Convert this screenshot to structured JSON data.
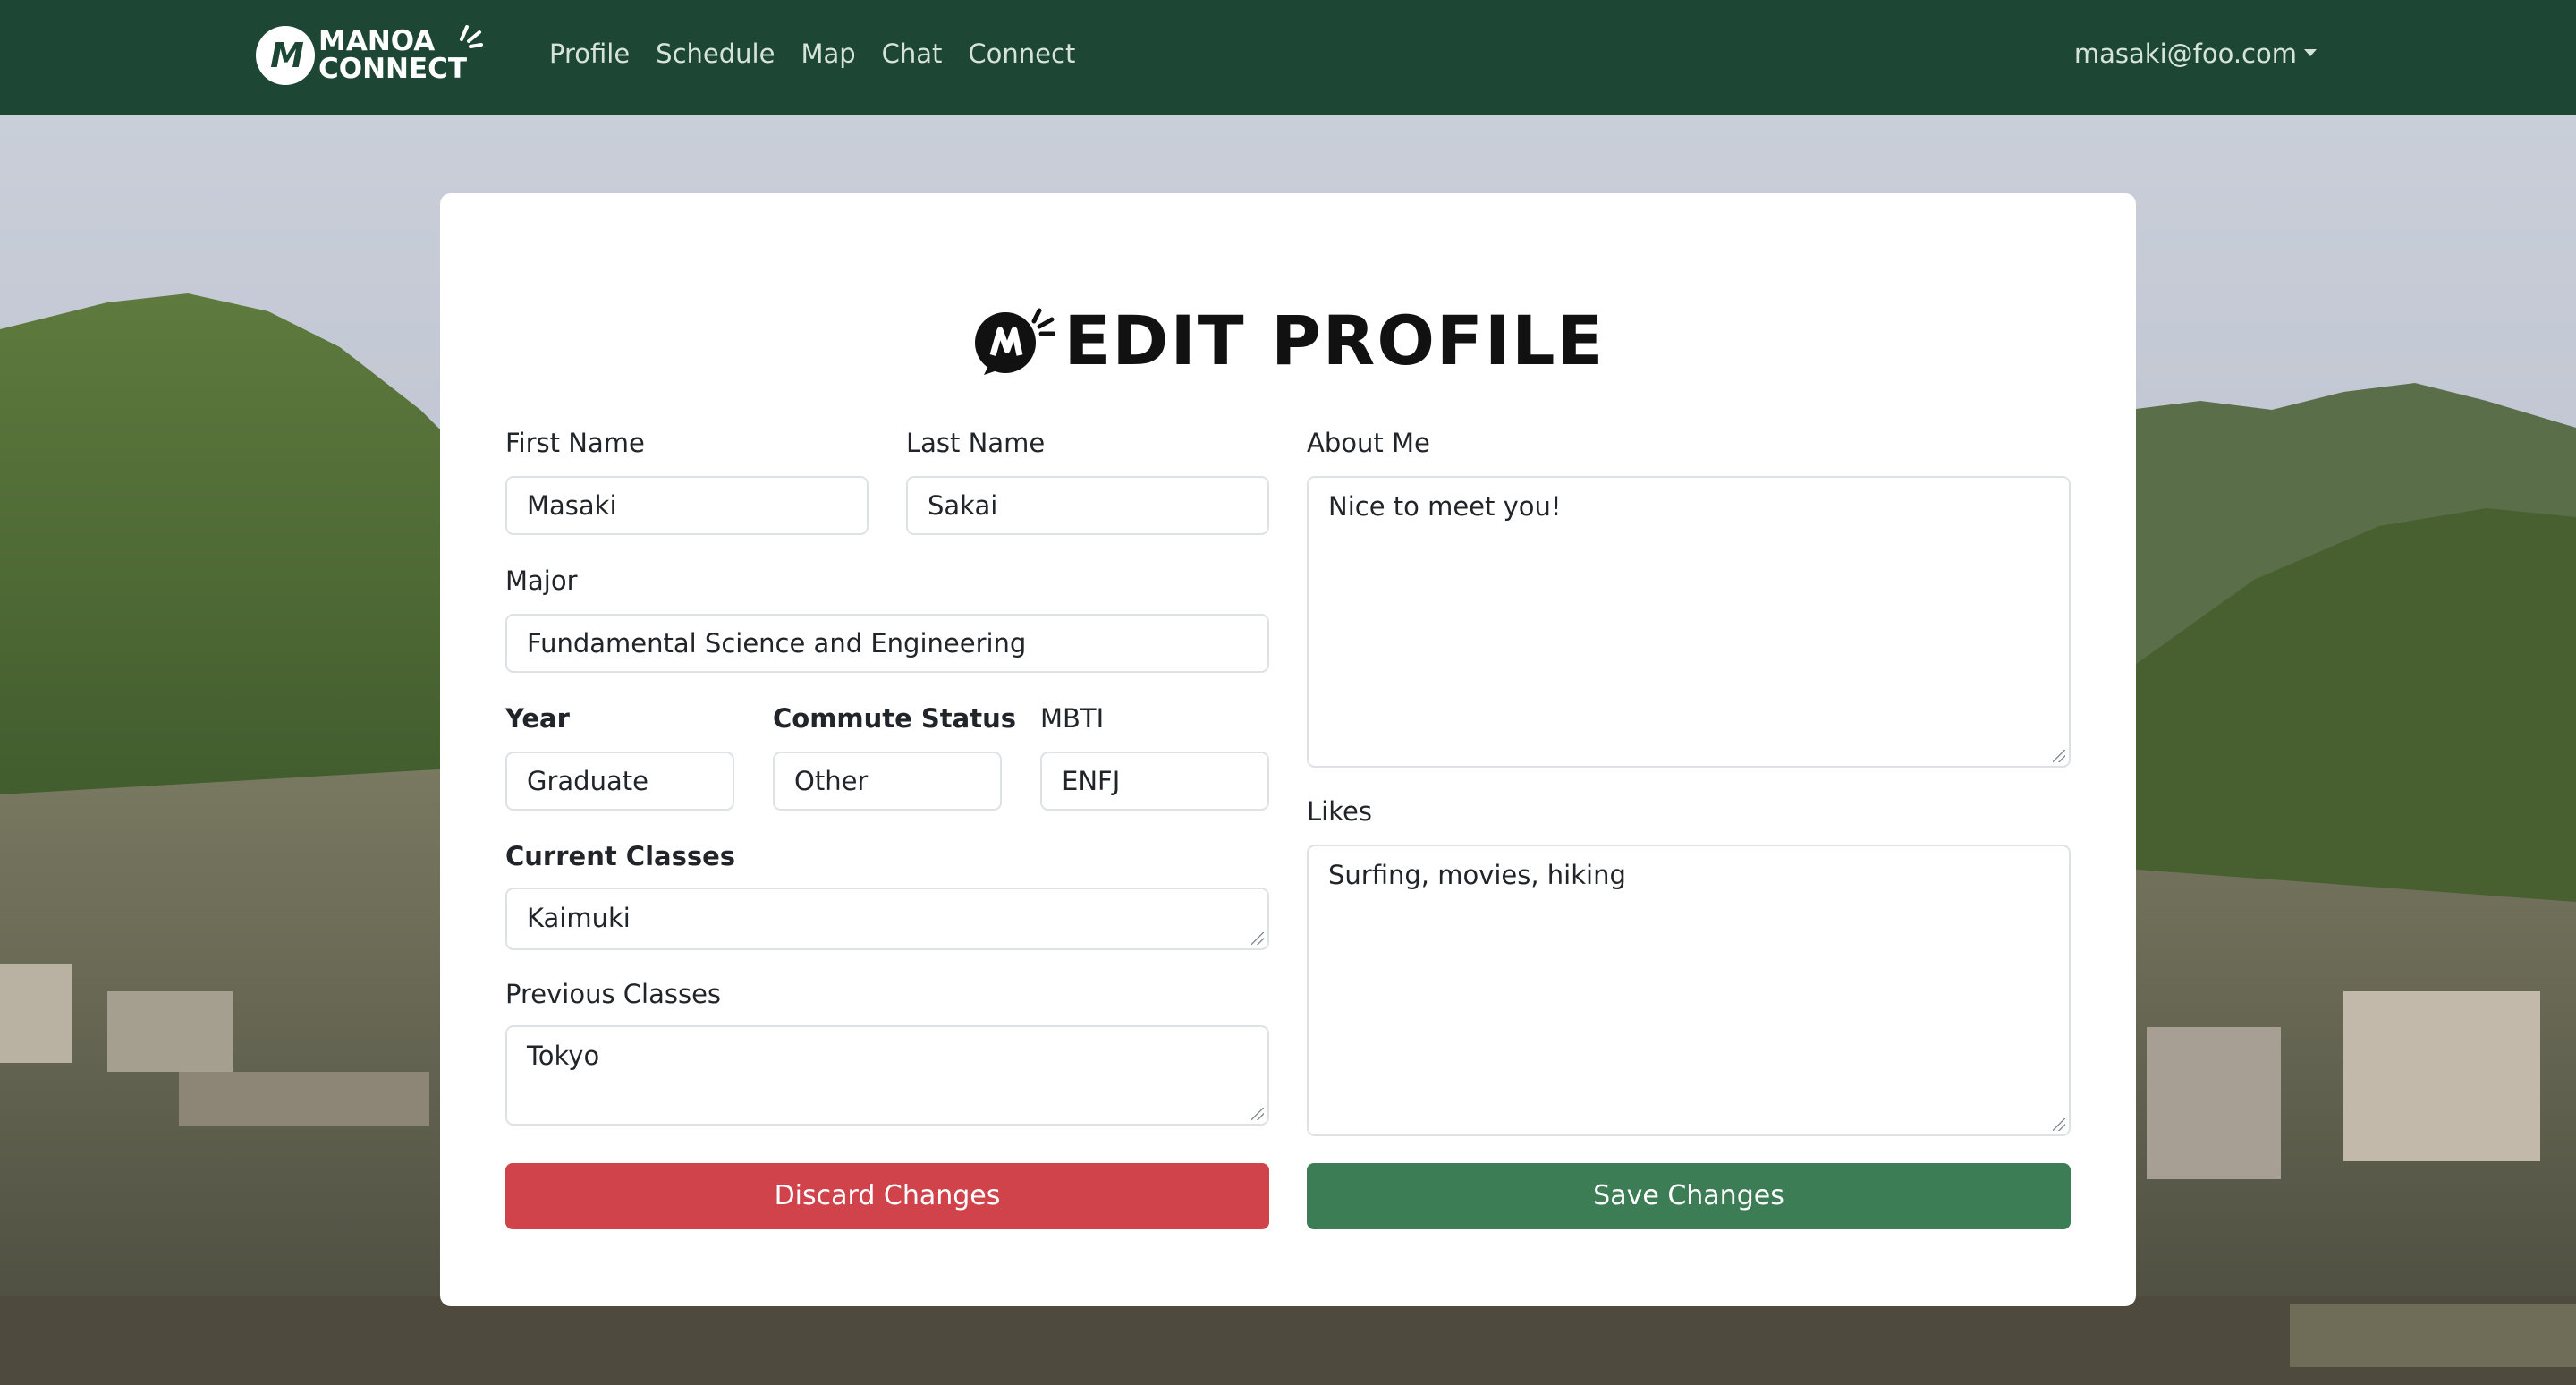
{
  "brand": {
    "line1": "MANOA",
    "line2": "CONNECT"
  },
  "nav": {
    "links": [
      "Profile",
      "Schedule",
      "Map",
      "Chat",
      "Connect"
    ],
    "user_email": "masaki@foo.com"
  },
  "page": {
    "title": "EDIT PROFILE"
  },
  "form": {
    "first_name": {
      "label": "First Name",
      "value": "Masaki"
    },
    "last_name": {
      "label": "Last Name",
      "value": "Sakai"
    },
    "major": {
      "label": "Major",
      "value": "Fundamental Science and Engineering"
    },
    "year": {
      "label": "Year",
      "value": "Graduate"
    },
    "commute_status": {
      "label": "Commute Status",
      "value": "Other"
    },
    "mbti": {
      "label": "MBTI",
      "value": "ENFJ"
    },
    "current_classes": {
      "label": "Current Classes",
      "value": "Kaimuki"
    },
    "previous_classes": {
      "label": "Previous Classes",
      "value": "Tokyo"
    },
    "about_me": {
      "label": "About Me",
      "value": "Nice to meet you!"
    },
    "likes": {
      "label": "Likes",
      "value": "Surfing, movies, hiking"
    },
    "discard_label": "Discard Changes",
    "save_label": "Save Changes"
  },
  "colors": {
    "navbar": "#1d4734",
    "discard": "#d0434a",
    "save": "#3c7d55"
  }
}
